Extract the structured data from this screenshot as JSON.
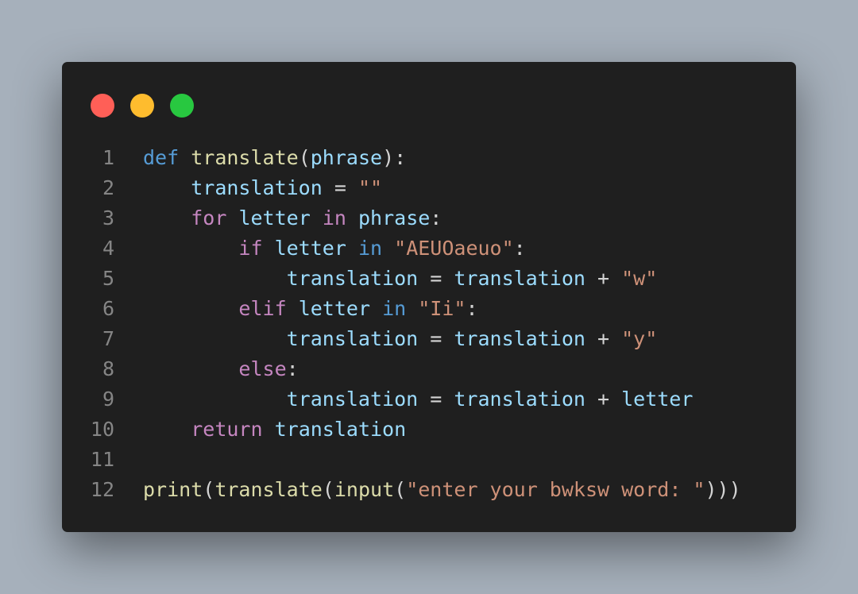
{
  "window": {
    "controls": [
      {
        "name": "close",
        "color": "#ff5f57"
      },
      {
        "name": "minimize",
        "color": "#febc2e"
      },
      {
        "name": "maximize",
        "color": "#28c840"
      }
    ]
  },
  "code": {
    "language": "python",
    "lines": [
      {
        "num": "1",
        "tokens": [
          {
            "t": "def",
            "c": "kw"
          },
          {
            "t": " ",
            "c": "op"
          },
          {
            "t": "translate",
            "c": "fn"
          },
          {
            "t": "(",
            "c": "op"
          },
          {
            "t": "phrase",
            "c": "var"
          },
          {
            "t": "):",
            "c": "op"
          }
        ]
      },
      {
        "num": "2",
        "tokens": [
          {
            "t": "    ",
            "c": "op"
          },
          {
            "t": "translation",
            "c": "var"
          },
          {
            "t": " = ",
            "c": "op"
          },
          {
            "t": "\"\"",
            "c": "str"
          }
        ]
      },
      {
        "num": "3",
        "tokens": [
          {
            "t": "    ",
            "c": "op"
          },
          {
            "t": "for",
            "c": "ctrl"
          },
          {
            "t": " ",
            "c": "op"
          },
          {
            "t": "letter",
            "c": "var"
          },
          {
            "t": " ",
            "c": "op"
          },
          {
            "t": "in",
            "c": "ctrl"
          },
          {
            "t": " ",
            "c": "op"
          },
          {
            "t": "phrase",
            "c": "var"
          },
          {
            "t": ":",
            "c": "op"
          }
        ]
      },
      {
        "num": "4",
        "tokens": [
          {
            "t": "        ",
            "c": "op"
          },
          {
            "t": "if",
            "c": "ctrl"
          },
          {
            "t": " ",
            "c": "op"
          },
          {
            "t": "letter",
            "c": "var"
          },
          {
            "t": " ",
            "c": "op"
          },
          {
            "t": "in",
            "c": "kw"
          },
          {
            "t": " ",
            "c": "op"
          },
          {
            "t": "\"AEUOaeuo\"",
            "c": "str"
          },
          {
            "t": ":",
            "c": "op"
          }
        ]
      },
      {
        "num": "5",
        "tokens": [
          {
            "t": "            ",
            "c": "op"
          },
          {
            "t": "translation",
            "c": "var"
          },
          {
            "t": " = ",
            "c": "op"
          },
          {
            "t": "translation",
            "c": "var"
          },
          {
            "t": " + ",
            "c": "op"
          },
          {
            "t": "\"w\"",
            "c": "str"
          }
        ]
      },
      {
        "num": "6",
        "tokens": [
          {
            "t": "        ",
            "c": "op"
          },
          {
            "t": "elif",
            "c": "ctrl"
          },
          {
            "t": " ",
            "c": "op"
          },
          {
            "t": "letter",
            "c": "var"
          },
          {
            "t": " ",
            "c": "op"
          },
          {
            "t": "in",
            "c": "kw"
          },
          {
            "t": " ",
            "c": "op"
          },
          {
            "t": "\"Ii\"",
            "c": "str"
          },
          {
            "t": ":",
            "c": "op"
          }
        ]
      },
      {
        "num": "7",
        "tokens": [
          {
            "t": "            ",
            "c": "op"
          },
          {
            "t": "translation",
            "c": "var"
          },
          {
            "t": " = ",
            "c": "op"
          },
          {
            "t": "translation",
            "c": "var"
          },
          {
            "t": " + ",
            "c": "op"
          },
          {
            "t": "\"y\"",
            "c": "str"
          }
        ]
      },
      {
        "num": "8",
        "tokens": [
          {
            "t": "        ",
            "c": "op"
          },
          {
            "t": "else",
            "c": "ctrl"
          },
          {
            "t": ":",
            "c": "op"
          }
        ]
      },
      {
        "num": "9",
        "tokens": [
          {
            "t": "            ",
            "c": "op"
          },
          {
            "t": "translation",
            "c": "var"
          },
          {
            "t": " = ",
            "c": "op"
          },
          {
            "t": "translation",
            "c": "var"
          },
          {
            "t": " + ",
            "c": "op"
          },
          {
            "t": "letter",
            "c": "var"
          }
        ]
      },
      {
        "num": "10",
        "tokens": [
          {
            "t": "    ",
            "c": "op"
          },
          {
            "t": "return",
            "c": "ctrl"
          },
          {
            "t": " ",
            "c": "op"
          },
          {
            "t": "translation",
            "c": "var"
          }
        ]
      },
      {
        "num": "11",
        "tokens": []
      },
      {
        "num": "12",
        "tokens": [
          {
            "t": "print",
            "c": "fn"
          },
          {
            "t": "(",
            "c": "op"
          },
          {
            "t": "translate",
            "c": "fn"
          },
          {
            "t": "(",
            "c": "op"
          },
          {
            "t": "input",
            "c": "fn"
          },
          {
            "t": "(",
            "c": "op"
          },
          {
            "t": "\"enter your bwksw word: \"",
            "c": "str"
          },
          {
            "t": ")))",
            "c": "op"
          }
        ]
      }
    ]
  }
}
